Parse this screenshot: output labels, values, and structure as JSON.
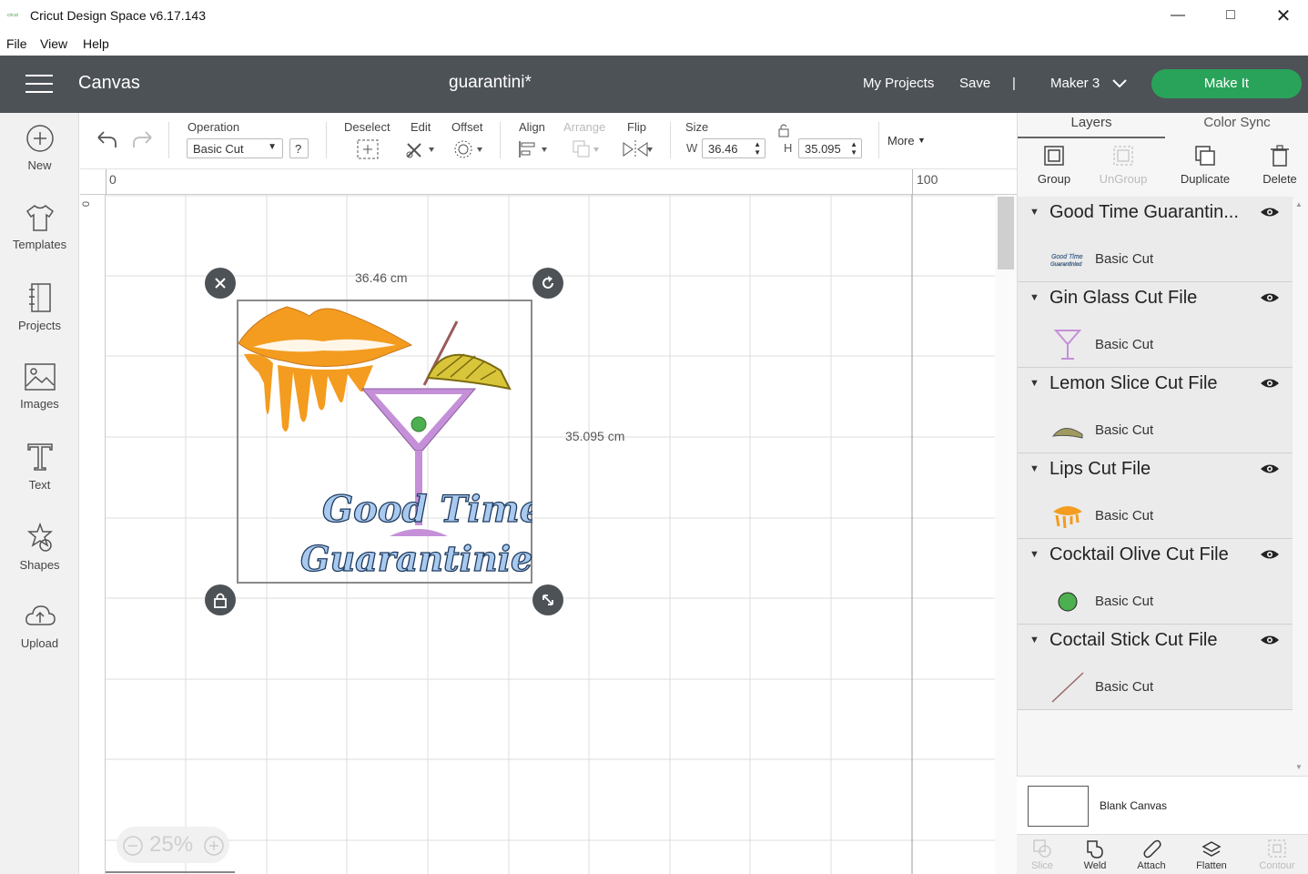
{
  "window": {
    "app_title": "Cricut Design Space  v6.17.143",
    "logo_text": "cricut"
  },
  "menu": [
    "File",
    "View",
    "Help"
  ],
  "header": {
    "section": "Canvas",
    "project": "guarantini*",
    "my_projects": "My Projects",
    "save": "Save",
    "divider": "|",
    "machine": "Maker 3",
    "make_it": "Make It"
  },
  "leftnav": [
    "New",
    "Templates",
    "Projects",
    "Images",
    "Text",
    "Shapes",
    "Upload"
  ],
  "toolbar": {
    "operation_label": "Operation",
    "operation_value": "Basic Cut",
    "help": "?",
    "deselect": "Deselect",
    "edit": "Edit",
    "offset": "Offset",
    "align": "Align",
    "arrange": "Arrange",
    "flip": "Flip",
    "size": "Size",
    "w_label": "W",
    "w_value": "36.46",
    "h_label": "H",
    "h_value": "35.095",
    "more": "More"
  },
  "ruler": {
    "h0": "0",
    "h100": "100",
    "v0": "0"
  },
  "canvas": {
    "width_label": "36.46 cm",
    "height_label": "35.095 cm",
    "design_text_line1": "Good Time",
    "design_text_line2": "Guarantinied",
    "zoom": "25%"
  },
  "panel": {
    "tabs": [
      "Layers",
      "Color Sync"
    ],
    "actions": [
      "Group",
      "UnGroup",
      "Duplicate",
      "Delete"
    ],
    "layers": [
      {
        "name": "Good Time Guarantin...",
        "op": "Basic Cut"
      },
      {
        "name": "Gin Glass Cut File",
        "op": "Basic Cut"
      },
      {
        "name": "Lemon Slice Cut File",
        "op": "Basic Cut"
      },
      {
        "name": "Lips Cut File",
        "op": "Basic Cut"
      },
      {
        "name": "Cocktail Olive Cut File",
        "op": "Basic Cut"
      },
      {
        "name": "Coctail Stick Cut File",
        "op": "Basic Cut"
      }
    ],
    "blank_canvas": "Blank Canvas",
    "bottom": [
      "Slice",
      "Weld",
      "Attach",
      "Flatten",
      "Contour"
    ]
  },
  "colors": {
    "header_bg": "#4d5257",
    "make_it": "#29a35a",
    "lips": "#f39c1f",
    "glass": "#c590d8",
    "olive": "#4caf50",
    "lemon": "#d8c53a",
    "text_fill": "#a9c9ee"
  }
}
